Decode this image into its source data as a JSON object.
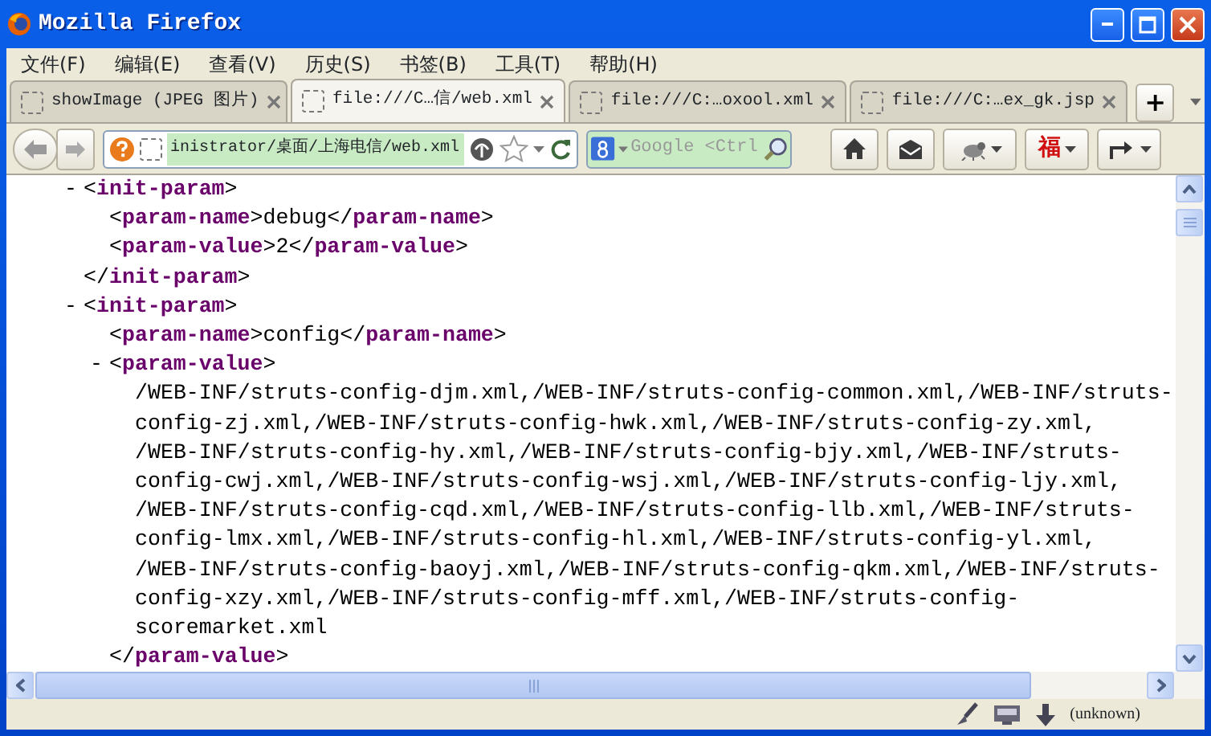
{
  "window": {
    "title": "Mozilla Firefox"
  },
  "menu": [
    {
      "label": "文件(F)"
    },
    {
      "label": "编辑(E)"
    },
    {
      "label": "查看(V)"
    },
    {
      "label": "历史(S)"
    },
    {
      "label": "书签(B)"
    },
    {
      "label": "工具(T)"
    },
    {
      "label": "帮助(H)"
    }
  ],
  "tabs": [
    {
      "label": "showImage (JPEG 图片)",
      "selected": false
    },
    {
      "label": "file:///C…信/web.xml",
      "selected": true
    },
    {
      "label": "file:///C:…oxool.xml",
      "selected": false
    },
    {
      "label": "file:///C:…ex_gk.jsp",
      "selected": false
    }
  ],
  "new_tab": "+",
  "toolbar": {
    "url": "inistrator/桌面/上海电信/web.xml",
    "search_placeholder": "Google <Ctrl",
    "addon_button": "福"
  },
  "document": {
    "nodes": [
      {
        "kind": "element",
        "toggle": "-",
        "open": "<init-param>",
        "close": "</init-param>",
        "children": [
          {
            "kind": "leaf",
            "open": "<param-name>",
            "text": "debug",
            "close": "</param-name>"
          },
          {
            "kind": "leaf",
            "open": "<param-value>",
            "text": "2",
            "close": "</param-value>"
          }
        ]
      },
      {
        "kind": "element",
        "toggle": "-",
        "open": "<init-param>",
        "children": [
          {
            "kind": "leaf",
            "open": "<param-name>",
            "text": "config",
            "close": "</param-name>"
          },
          {
            "kind": "element",
            "toggle": "-",
            "open": "<param-value>",
            "close": "</param-value>",
            "children": [
              {
                "kind": "text",
                "lines": [
                  "/WEB-INF/struts-config-djm.xml,/WEB-INF/struts-config-common.xml,/WEB-INF/struts-",
                  "config-zj.xml,/WEB-INF/struts-config-hwk.xml,/WEB-INF/struts-config-zy.xml,",
                  "/WEB-INF/struts-config-hy.xml,/WEB-INF/struts-config-bjy.xml,/WEB-INF/struts-",
                  "config-cwj.xml,/WEB-INF/struts-config-wsj.xml,/WEB-INF/struts-config-ljy.xml,",
                  "/WEB-INF/struts-config-cqd.xml,/WEB-INF/struts-config-llb.xml,/WEB-INF/struts-",
                  "config-lmx.xml,/WEB-INF/struts-config-hl.xml,/WEB-INF/struts-config-yl.xml,",
                  "/WEB-INF/struts-config-baoyj.xml,/WEB-INF/struts-config-qkm.xml,/WEB-INF/struts-",
                  "config-xzy.xml,/WEB-INF/struts-config-mff.xml,/WEB-INF/struts-config-",
                  "scoremarket.xml"
                ]
              }
            ]
          }
        ]
      }
    ]
  },
  "status_bar": {
    "text": "(unknown)"
  }
}
